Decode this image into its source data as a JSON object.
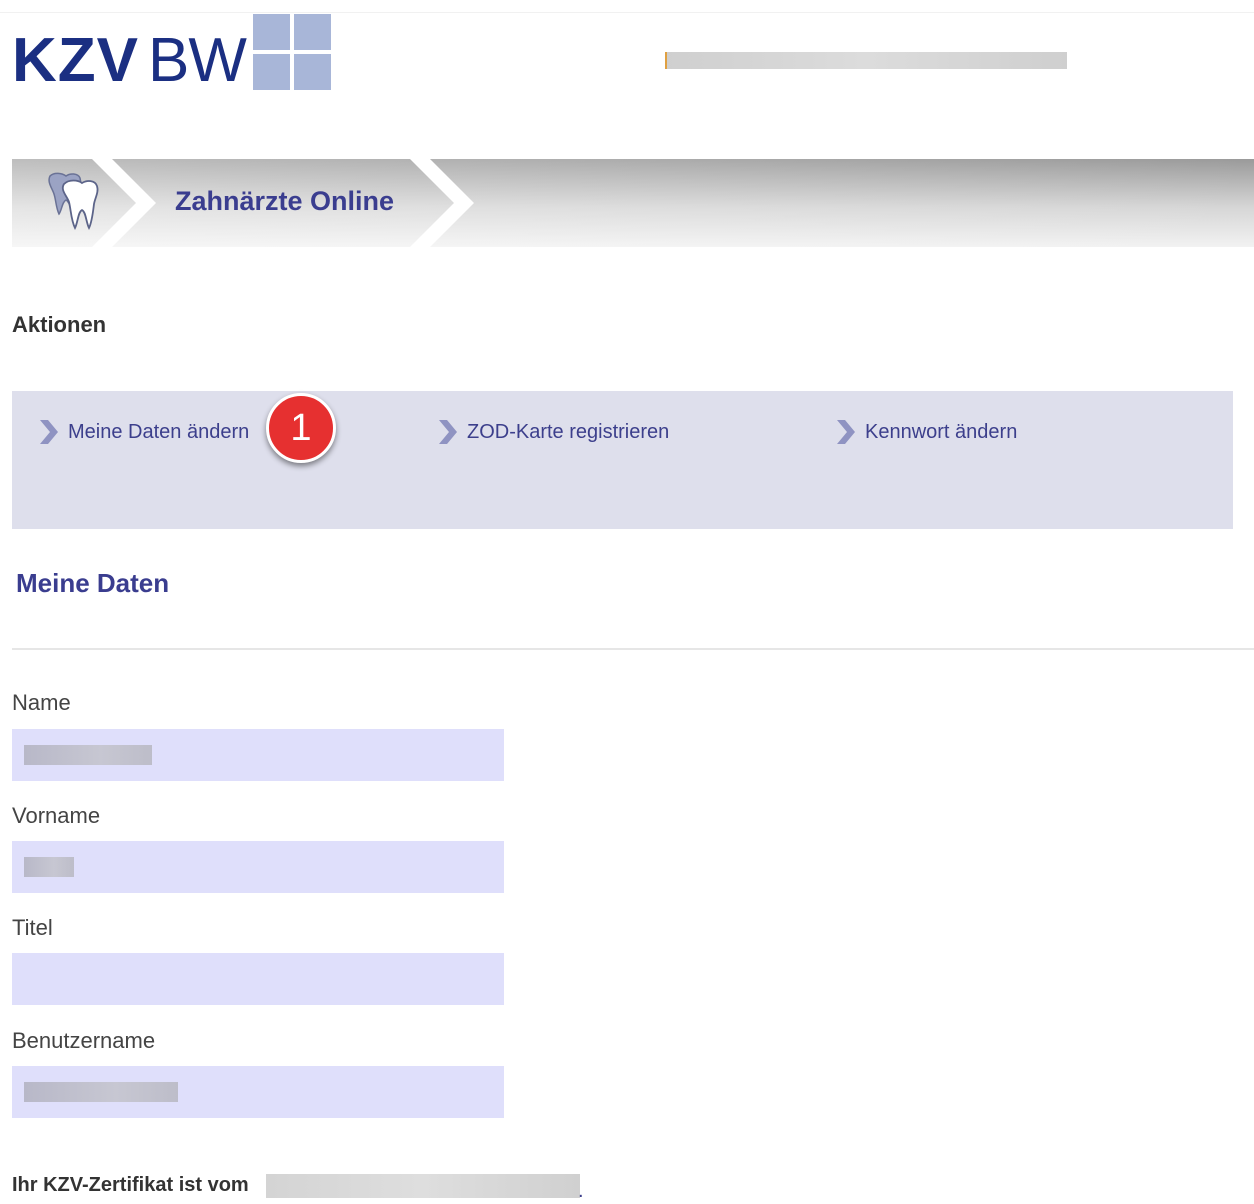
{
  "logo": {
    "part1": "KZV",
    "part2": "BW"
  },
  "banner": {
    "title": "Zahnärzte Online"
  },
  "actions_heading": "Aktionen",
  "actions": [
    {
      "label": "Meine Daten ändern"
    },
    {
      "label": "ZOD-Karte registrieren"
    },
    {
      "label": "Kennwort ändern"
    }
  ],
  "annotation_badge": "1",
  "section_title": "Meine Daten",
  "form": {
    "name_label": "Name",
    "vorname_label": "Vorname",
    "titel_label": "Titel",
    "benutzername_label": "Benutzername"
  },
  "certificate": {
    "text": "Ihr KZV-Zertifikat ist vom",
    "end": "."
  },
  "colors": {
    "brand_blue": "#1b2f82",
    "accent": "#3a3d8f",
    "action_bar_bg": "#dedfec",
    "input_bg": "#dfdffb",
    "badge": "#e63030"
  },
  "icons": [
    "tooth-icon",
    "chevron-right-icon"
  ]
}
